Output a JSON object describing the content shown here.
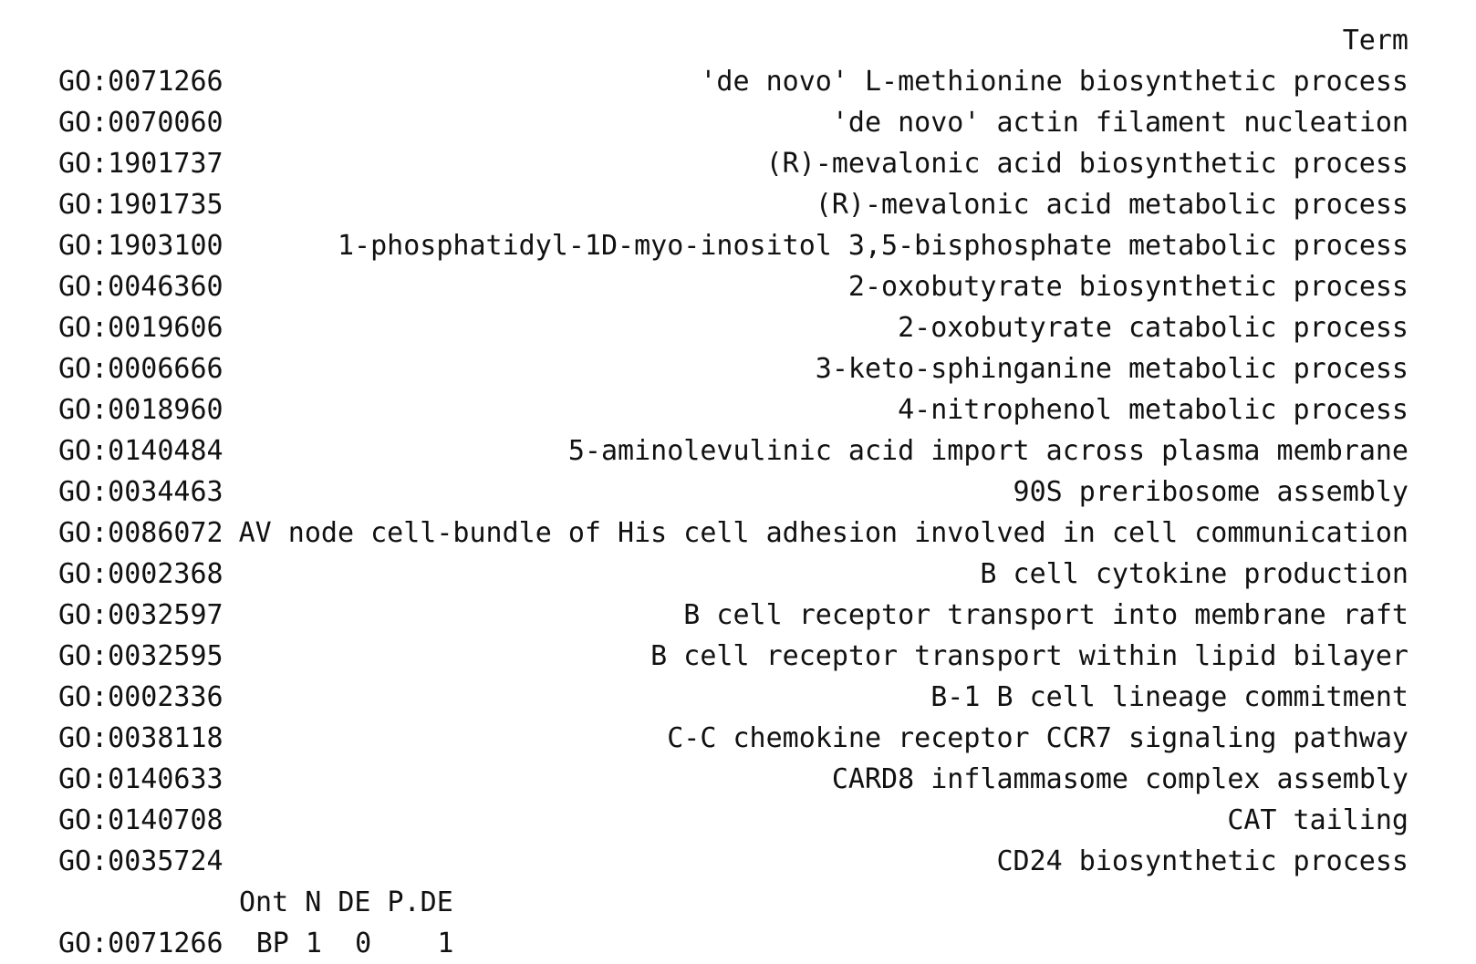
{
  "console": {
    "header_term": "Term",
    "rows": [
      {
        "id": "GO:0071266",
        "term": "'de novo' L-methionine biosynthetic process"
      },
      {
        "id": "GO:0070060",
        "term": "'de novo' actin filament nucleation"
      },
      {
        "id": "GO:1901737",
        "term": "(R)-mevalonic acid biosynthetic process"
      },
      {
        "id": "GO:1901735",
        "term": "(R)-mevalonic acid metabolic process"
      },
      {
        "id": "GO:1903100",
        "term": "1-phosphatidyl-1D-myo-inositol 3,5-bisphosphate metabolic process"
      },
      {
        "id": "GO:0046360",
        "term": "2-oxobutyrate biosynthetic process"
      },
      {
        "id": "GO:0019606",
        "term": "2-oxobutyrate catabolic process"
      },
      {
        "id": "GO:0006666",
        "term": "3-keto-sphinganine metabolic process"
      },
      {
        "id": "GO:0018960",
        "term": "4-nitrophenol metabolic process"
      },
      {
        "id": "GO:0140484",
        "term": "5-aminolevulinic acid import across plasma membrane"
      },
      {
        "id": "GO:0034463",
        "term": "90S preribosome assembly"
      },
      {
        "id": "GO:0086072",
        "term": "AV node cell-bundle of His cell adhesion involved in cell communication"
      },
      {
        "id": "GO:0002368",
        "term": "B cell cytokine production"
      },
      {
        "id": "GO:0032597",
        "term": "B cell receptor transport into membrane raft"
      },
      {
        "id": "GO:0032595",
        "term": "B cell receptor transport within lipid bilayer"
      },
      {
        "id": "GO:0002336",
        "term": "B-1 B cell lineage commitment"
      },
      {
        "id": "GO:0038118",
        "term": "C-C chemokine receptor CCR7 signaling pathway"
      },
      {
        "id": "GO:0140633",
        "term": "CARD8 inflammasome complex assembly"
      },
      {
        "id": "GO:0140708",
        "term": "CAT tailing"
      },
      {
        "id": "GO:0035724",
        "term": "CD24 biosynthetic process"
      }
    ],
    "sub_header": "Ont N DE P.DE",
    "partial_row": "GO:0071266  BP 1  0    1"
  }
}
